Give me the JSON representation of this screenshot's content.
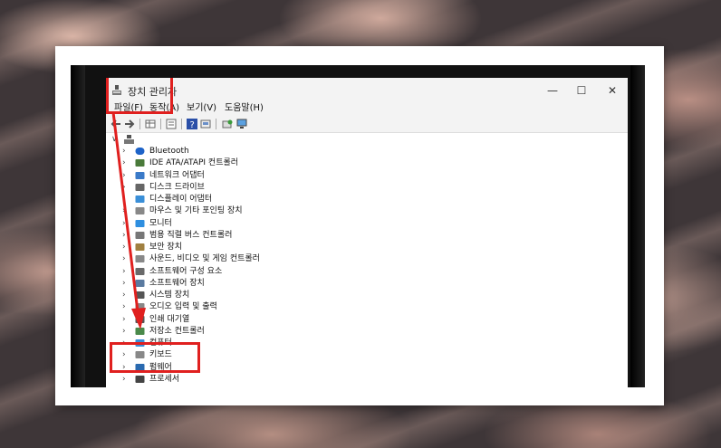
{
  "window": {
    "title": "장치 관리자"
  },
  "menu": [
    "파일(F)",
    "동작(A)",
    "보기(V)",
    "도움말(H)"
  ],
  "window_buttons": {
    "minimize": "—",
    "maximize": "☐",
    "close": "✕"
  },
  "tree": {
    "root_chevron": "∨",
    "items": [
      {
        "label": "Bluetooth",
        "icon": "bluetooth-icon"
      },
      {
        "label": "IDE ATA/ATAPI 컨트롤러",
        "icon": "ide-controller-icon"
      },
      {
        "label": "네트워크 어댑터",
        "icon": "network-adapter-icon"
      },
      {
        "label": "디스크 드라이브",
        "icon": "disk-drive-icon"
      },
      {
        "label": "디스플레이 어댑터",
        "icon": "display-adapter-icon"
      },
      {
        "label": "마우스 및 기타 포인팅 장치",
        "icon": "mouse-icon"
      },
      {
        "label": "모니터",
        "icon": "monitor-icon"
      },
      {
        "label": "범용 직렬 버스 컨트롤러",
        "icon": "usb-icon"
      },
      {
        "label": "보안 장치",
        "icon": "security-device-icon"
      },
      {
        "label": "사운드, 비디오 및 게임 컨트롤러",
        "icon": "sound-icon"
      },
      {
        "label": "소프트웨어 구성 요소",
        "icon": "software-component-icon"
      },
      {
        "label": "소프트웨어 장치",
        "icon": "software-device-icon"
      },
      {
        "label": "시스템 장치",
        "icon": "system-device-icon"
      },
      {
        "label": "오디오 입력 및 출력",
        "icon": "audio-io-icon"
      },
      {
        "label": "인쇄 대기열",
        "icon": "print-queue-icon"
      },
      {
        "label": "저장소 컨트롤러",
        "icon": "storage-controller-icon"
      },
      {
        "label": "컴퓨터",
        "icon": "computer-icon"
      },
      {
        "label": "키보드",
        "icon": "keyboard-icon"
      },
      {
        "label": "펌웨어",
        "icon": "firmware-icon"
      },
      {
        "label": "프로세서",
        "icon": "processor-icon"
      }
    ],
    "chevron": "›"
  },
  "colors": {
    "highlight": "#e0201f",
    "titlebar": "#f3f3f3",
    "accent_blue": "#1e63c8"
  }
}
